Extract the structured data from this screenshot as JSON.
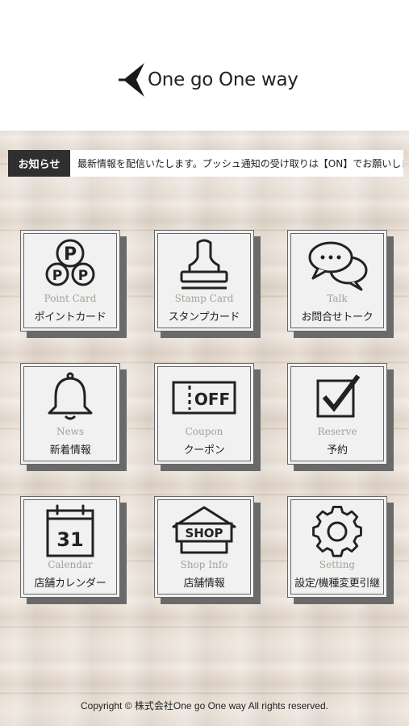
{
  "header": {
    "logo_text": "One go One way"
  },
  "news": {
    "label": "お知らせ",
    "text": "最新情報を配信いたします。プッシュ通知の受け取りは【ON】でお願いします。"
  },
  "tiles": [
    {
      "en": "Point Card",
      "jp": "ポイントカード",
      "icon": "point-card-icon"
    },
    {
      "en": "Stamp Card",
      "jp": "スタンプカード",
      "icon": "stamp-icon"
    },
    {
      "en": "Talk",
      "jp": "お問合せトーク",
      "icon": "chat-bubbles-icon"
    },
    {
      "en": "News",
      "jp": "新着情報",
      "icon": "bell-icon"
    },
    {
      "en": "Coupon",
      "jp": "クーポン",
      "icon": "coupon-icon",
      "icon_text": "OFF"
    },
    {
      "en": "Reserve",
      "jp": "予約",
      "icon": "checkbox-icon"
    },
    {
      "en": "Calendar",
      "jp": "店舗カレンダー",
      "icon": "calendar-icon",
      "icon_text": "31"
    },
    {
      "en": "Shop Info",
      "jp": "店舗情報",
      "icon": "shop-icon",
      "icon_text": "SHOP"
    },
    {
      "en": "Setting",
      "jp": "設定/機種変更引継",
      "icon": "gear-icon"
    }
  ],
  "footer": {
    "copyright": "Copyright © 株式会社One go One way All rights reserved."
  }
}
